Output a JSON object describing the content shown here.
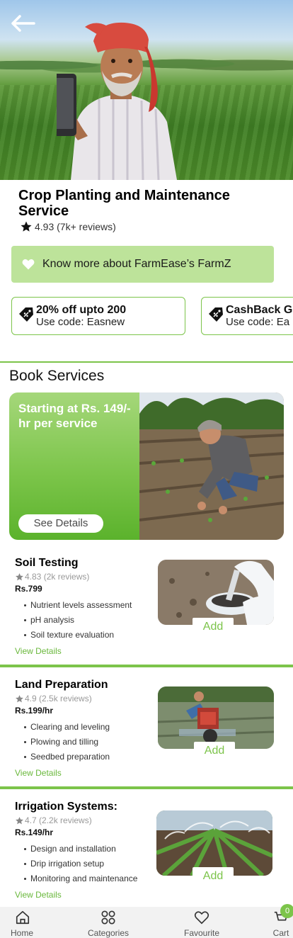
{
  "hero": {
    "back_icon": "arrow-left-icon"
  },
  "service": {
    "title": "Crop Planting and Maintenance Service",
    "rating": "4.93",
    "reviews": "(7k+ reviews)"
  },
  "know_more": {
    "label": "Know more about FarmEase’s FarmZ",
    "icon": "heart-icon"
  },
  "offers": [
    {
      "title": "20% off upto 200",
      "code": "Use code: Easnew",
      "icon": "discount-tag-icon"
    },
    {
      "title": "CashBack G",
      "code": "Use code: Ea",
      "icon": "discount-tag-icon"
    }
  ],
  "book_services": {
    "title": "Book Services",
    "banner_text": "Starting at Rs. 149/-hr per service",
    "banner_button": "See Details"
  },
  "services": [
    {
      "name": "Soil Testing",
      "rating": "4.83",
      "reviews": "(2k reviews)",
      "price": "Rs.799",
      "features": [
        "Nutrient levels assessment",
        "pH analysis",
        "Soil texture evaluation"
      ],
      "view": "View Details",
      "add": "Add"
    },
    {
      "name": "Land Preparation",
      "rating": "4.9",
      "reviews": "(2.5k reviews)",
      "price": "Rs.199/hr",
      "features": [
        "Clearing and leveling",
        "Plowing and tilling",
        "Seedbed preparation"
      ],
      "view": "View Details",
      "add": "Add"
    },
    {
      "name": "Irrigation Systems:",
      "rating": "4.7",
      "reviews": "(2.2k reviews)",
      "price": "Rs.149/hr",
      "features": [
        "Design and installation",
        "Drip irrigation setup",
        "Monitoring and maintenance"
      ],
      "view": "View Details",
      "add": "Add"
    }
  ],
  "bottom_nav": {
    "items": [
      {
        "label": "Home",
        "icon": "home-icon"
      },
      {
        "label": "Categories",
        "icon": "grid-icon"
      },
      {
        "label": "Favourite",
        "icon": "heart-icon"
      },
      {
        "label": "Cart",
        "icon": "cart-icon"
      }
    ],
    "cart_count": "0"
  },
  "colors": {
    "accent": "#7cc44a",
    "light_green": "#bde39a"
  }
}
